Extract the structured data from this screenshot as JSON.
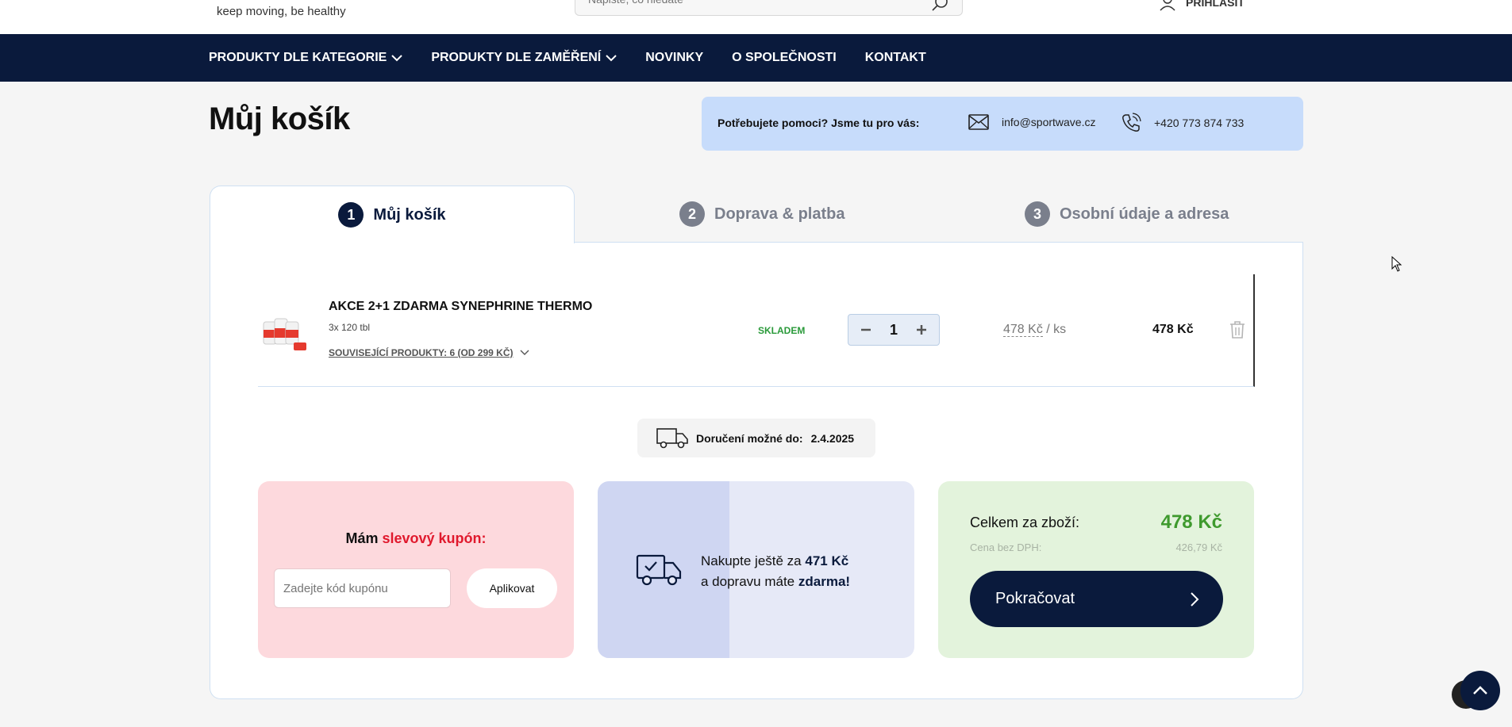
{
  "header": {
    "tagline": "keep moving, be healthy",
    "search_placeholder": "Napište, co hledáte",
    "login_label": "PŘIHLÁSIT"
  },
  "nav": {
    "items": [
      {
        "label": "PRODUKTY DLE KATEGORIE",
        "dropdown": true
      },
      {
        "label": "PRODUKTY DLE ZAMĚŘENÍ",
        "dropdown": true
      },
      {
        "label": "NOVINKY",
        "dropdown": false
      },
      {
        "label": "O SPOLEČNOSTI",
        "dropdown": false
      },
      {
        "label": "KONTAKT",
        "dropdown": false
      }
    ]
  },
  "page": {
    "title": "Můj košík"
  },
  "help": {
    "text": "Potřebujete pomoci? Jsme tu pro vás:",
    "email": "info@sportwave.cz",
    "phone": "+420 773 874 733"
  },
  "steps": [
    {
      "num": "1",
      "label": "Můj košík",
      "active": true
    },
    {
      "num": "2",
      "label": "Doprava & platba",
      "active": false
    },
    {
      "num": "3",
      "label": "Osobní údaje a adresa",
      "active": false
    }
  ],
  "product": {
    "name": "AKCE 2+1 ZDARMA SYNEPHRINE THERMO",
    "variant": "3x 120 tbl",
    "related": "SOUVISEJÍCÍ PRODUKTY: 6 (OD 299 KČ)",
    "stock": "SKLADEM",
    "quantity": "1",
    "unit_price": "478 Kč",
    "unit_suffix": "/ ks",
    "total": "478 Kč"
  },
  "delivery": {
    "label": "Doručení možné do:",
    "date": "2.4.2025"
  },
  "coupon": {
    "title_prefix": "Mám",
    "title_highlight": "slevový kupón:",
    "placeholder": "Zadejte kód kupónu",
    "apply_label": "Aplikovat"
  },
  "free_shipping": {
    "line1_prefix": "Nakupte ještě za",
    "line1_amount": "471 Kč",
    "line2_prefix": "a dopravu máte",
    "line2_highlight": "zdarma!",
    "progress": 0.415
  },
  "summary": {
    "total_label": "Celkem za zboží:",
    "total_value": "478 Kč",
    "net_label": "Cena bez DPH:",
    "net_value": "426,79 Kč",
    "continue_label": "Pokračovat"
  },
  "colors": {
    "navy": "#0a1a3c",
    "green": "#3f9a2e",
    "red": "#e0192d",
    "stock_green": "#2a9a3a"
  }
}
